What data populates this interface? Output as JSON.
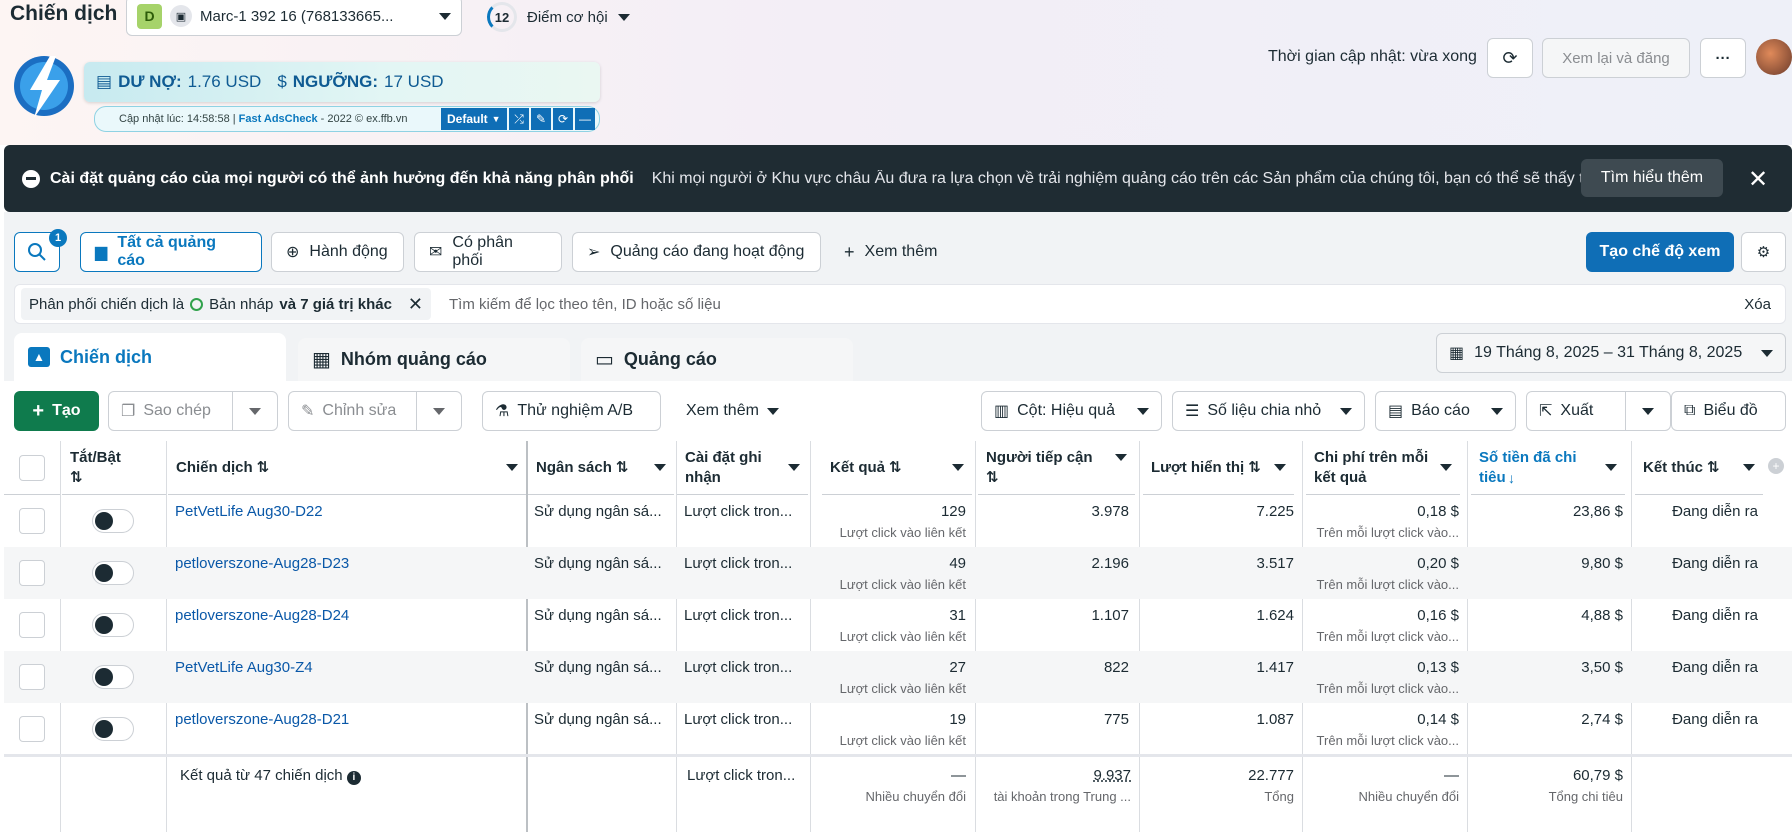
{
  "header": {
    "title": "Chiến dịch",
    "account_badge": "D",
    "account_name": "Marc-1 392 16 (768133665...",
    "opportunity_score": "12",
    "opportunity_label": "Điểm cơ hội",
    "update_time": "Thời gian cập nhật: vừa xong",
    "review_publish": "Xem lại và đăng",
    "more": "···"
  },
  "extension": {
    "debt_label": "DƯ NỢ:",
    "debt_value": "1.76 USD",
    "threshold_label": "NGƯỠNG:",
    "threshold_value": "17 USD",
    "updated_at": "Cập nhật lúc: 14:58:58 |",
    "brand": "Fast AdsCheck",
    "copyright": "- 2022 © ex.ffb.vn",
    "mode": "Default"
  },
  "banner": {
    "heading": "Cài đặt quảng cáo của mọi người có thể ảnh hưởng đến khả năng phân phối",
    "text": "Khi mọi người ở Khu vực châu Âu đưa ra lựa chọn về trải nghiệm quảng cáo trên các Sản phẩm của chúng tôi, bạn có thể sẽ thấy tác...",
    "learn_more": "Tìm hiểu thêm",
    "close": "✕"
  },
  "filters": {
    "search_badge": "1",
    "chips": [
      "Tất cả quảng cáo",
      "Hành động",
      "Có phân phối",
      "Quảng cáo đang hoạt động"
    ],
    "see_more": "Xem thêm",
    "create_view": "Tạo chế độ xem",
    "active_filter_prefix": "Phân phối chiến dịch là",
    "active_filter_value": "Bản nháp",
    "active_filter_suffix": "và 7 giá trị khác",
    "search_placeholder": "Tìm kiếm để lọc theo tên, ID hoặc số liệu",
    "clear": "Xóa"
  },
  "tabs": [
    "Chiến dịch",
    "Nhóm quảng cáo",
    "Quảng cáo"
  ],
  "date_range": "19 Tháng 8, 2025 – 31 Tháng 8, 2025",
  "toolbar": {
    "create": "Tạo",
    "duplicate": "Sao chép",
    "edit": "Chỉnh sửa",
    "ab_test": "Thử nghiệm A/B",
    "see_more": "Xem thêm",
    "columns": "Cột: Hiệu quả",
    "breakdown": "Số liệu chia nhỏ",
    "reports": "Báo cáo",
    "export": "Xuất",
    "charts": "Biểu đồ"
  },
  "table": {
    "headers": {
      "toggle": "Tắt/Bật",
      "campaign": "Chiến dịch",
      "budget": "Ngân sách",
      "attribution": "Cài đặt ghi nhận",
      "results": "Kết quả",
      "reach": "Người tiếp cận",
      "impressions": "Lượt hiển thị",
      "cost_per_result": "Chi phí trên mỗi kết quả",
      "amount_spent": "Số tiền đã chi tiêu",
      "end": "Kết thúc"
    },
    "rows": [
      {
        "name": "PetVetLife Aug30-D22",
        "budget": "Sử dụng ngân sá...",
        "attribution": "Lượt click tron...",
        "results": "129",
        "results_sub": "Lượt click vào liên kết",
        "reach": "3.978",
        "impressions": "7.225",
        "cpr": "0,18 $",
        "cpr_sub": "Trên mỗi lượt click vào...",
        "spent": "23,86 $",
        "end": "Đang diễn ra"
      },
      {
        "name": "petloverszone-Aug28-D23",
        "budget": "Sử dụng ngân sá...",
        "attribution": "Lượt click tron...",
        "results": "49",
        "results_sub": "Lượt click vào liên kết",
        "reach": "2.196",
        "impressions": "3.517",
        "cpr": "0,20 $",
        "cpr_sub": "Trên mỗi lượt click vào...",
        "spent": "9,80 $",
        "end": "Đang diễn ra"
      },
      {
        "name": "petloverszone-Aug28-D24",
        "budget": "Sử dụng ngân sá...",
        "attribution": "Lượt click tron...",
        "results": "31",
        "results_sub": "Lượt click vào liên kết",
        "reach": "1.107",
        "impressions": "1.624",
        "cpr": "0,16 $",
        "cpr_sub": "Trên mỗi lượt click vào...",
        "spent": "4,88 $",
        "end": "Đang diễn ra"
      },
      {
        "name": "PetVetLife Aug30-Z4",
        "budget": "Sử dụng ngân sá...",
        "attribution": "Lượt click tron...",
        "results": "27",
        "results_sub": "Lượt click vào liên kết",
        "reach": "822",
        "impressions": "1.417",
        "cpr": "0,13 $",
        "cpr_sub": "Trên mỗi lượt click vào...",
        "spent": "3,50 $",
        "end": "Đang diễn ra"
      },
      {
        "name": "petloverszone-Aug28-D21",
        "budget": "Sử dụng ngân sá...",
        "attribution": "Lượt click tron...",
        "results": "19",
        "results_sub": "Lượt click vào liên kết",
        "reach": "775",
        "impressions": "1.087",
        "cpr": "0,14 $",
        "cpr_sub": "Trên mỗi lượt click vào...",
        "spent": "2,74 $",
        "end": "Đang diễn ra"
      }
    ],
    "totals": {
      "label": "Kết quả từ 47 chiến dịch",
      "attribution": "Lượt click tron...",
      "results": "—",
      "results_sub": "Nhiều chuyển đổi",
      "reach": "9.937",
      "reach_sub": "tài khoản trong Trung ...",
      "impressions": "22.777",
      "impressions_sub": "Tổng",
      "cpr": "—",
      "cpr_sub": "Nhiều chuyển đổi",
      "spent": "60,79 $",
      "spent_sub": "Tổng chi tiêu"
    }
  }
}
